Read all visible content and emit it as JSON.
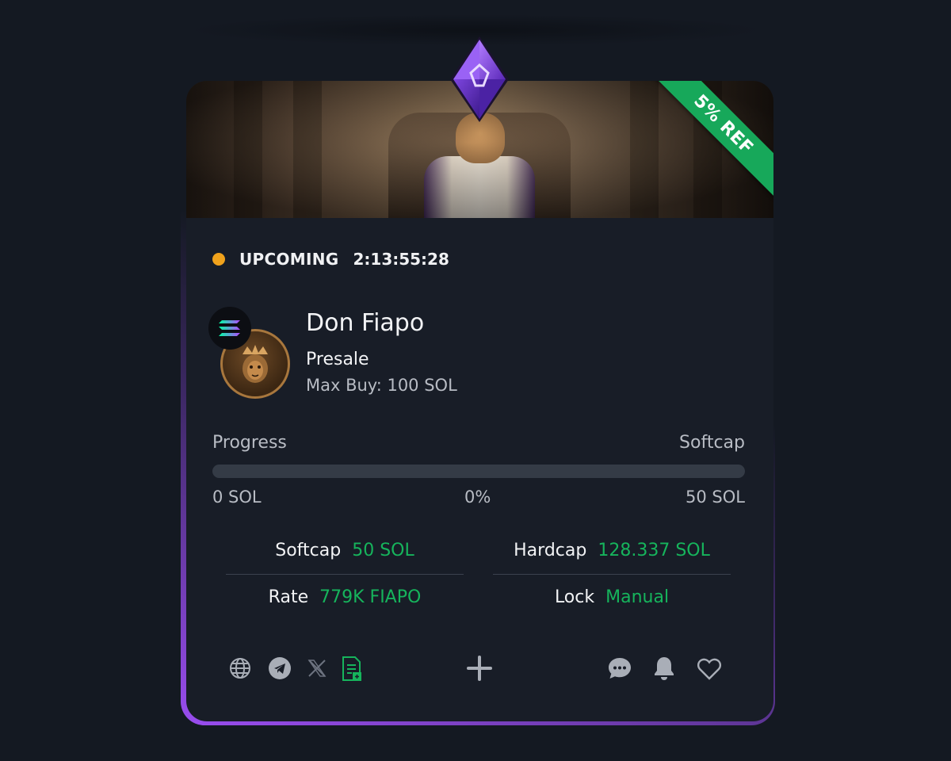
{
  "card": {
    "ribbon": "5% REF",
    "status": {
      "label": "UPCOMING",
      "timer": "2:13:55:28",
      "color": "#f0a21c"
    },
    "token": {
      "name": "Don Fiapo",
      "type": "Presale",
      "max_buy": "Max Buy: 100 SOL",
      "chain_icon": "solana-icon",
      "logo_icon": "lion-logo-icon"
    },
    "progress": {
      "label": "Progress",
      "cap_label": "Softcap",
      "min": "0 SOL",
      "percent_text": "0%",
      "percent_value": 0,
      "max": "50 SOL"
    },
    "stats": {
      "softcap": {
        "label": "Softcap",
        "value": "50 SOL"
      },
      "hardcap": {
        "label": "Hardcap",
        "value": "128.337 SOL"
      },
      "rate": {
        "label": "Rate",
        "value": "779K FIAPO"
      },
      "lock": {
        "label": "Lock",
        "value": "Manual"
      }
    },
    "accent_color": "#16b45c",
    "footer_icons": [
      "globe-icon",
      "telegram-icon",
      "x-icon",
      "document-icon",
      "plus-icon",
      "chat-icon",
      "bell-icon",
      "heart-icon"
    ]
  }
}
